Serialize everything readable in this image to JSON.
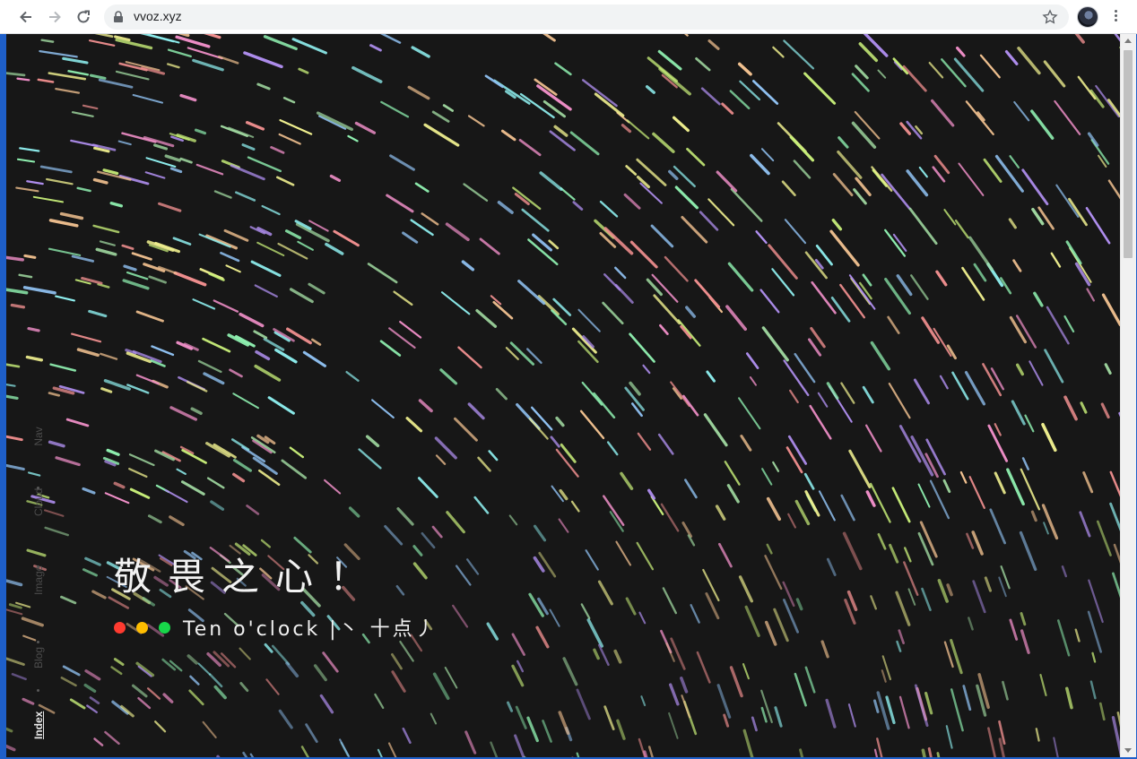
{
  "browser": {
    "url": "vvoz.xyz"
  },
  "page": {
    "title": "敬畏之心！",
    "subtitle": "Ten o'clock |丶 十点丿",
    "traffic_dots": [
      "#ff3b30",
      "#ffbd00",
      "#18d64a"
    ],
    "background": "#171717"
  },
  "side_nav": {
    "items": [
      {
        "label": "Nav",
        "active": false
      },
      {
        "label": "Cloud",
        "active": false
      },
      {
        "label": "Image",
        "active": false
      },
      {
        "label": "Blog",
        "active": false
      },
      {
        "label": "Index",
        "active": true
      }
    ]
  },
  "streak_palette": [
    "#8ff0b0",
    "#c9f07a",
    "#f08fc8",
    "#8fc0f0",
    "#b08ff0",
    "#f0c08f",
    "#8ff0f0",
    "#f0f08f",
    "#f08f8f",
    "#a0d8a0"
  ]
}
